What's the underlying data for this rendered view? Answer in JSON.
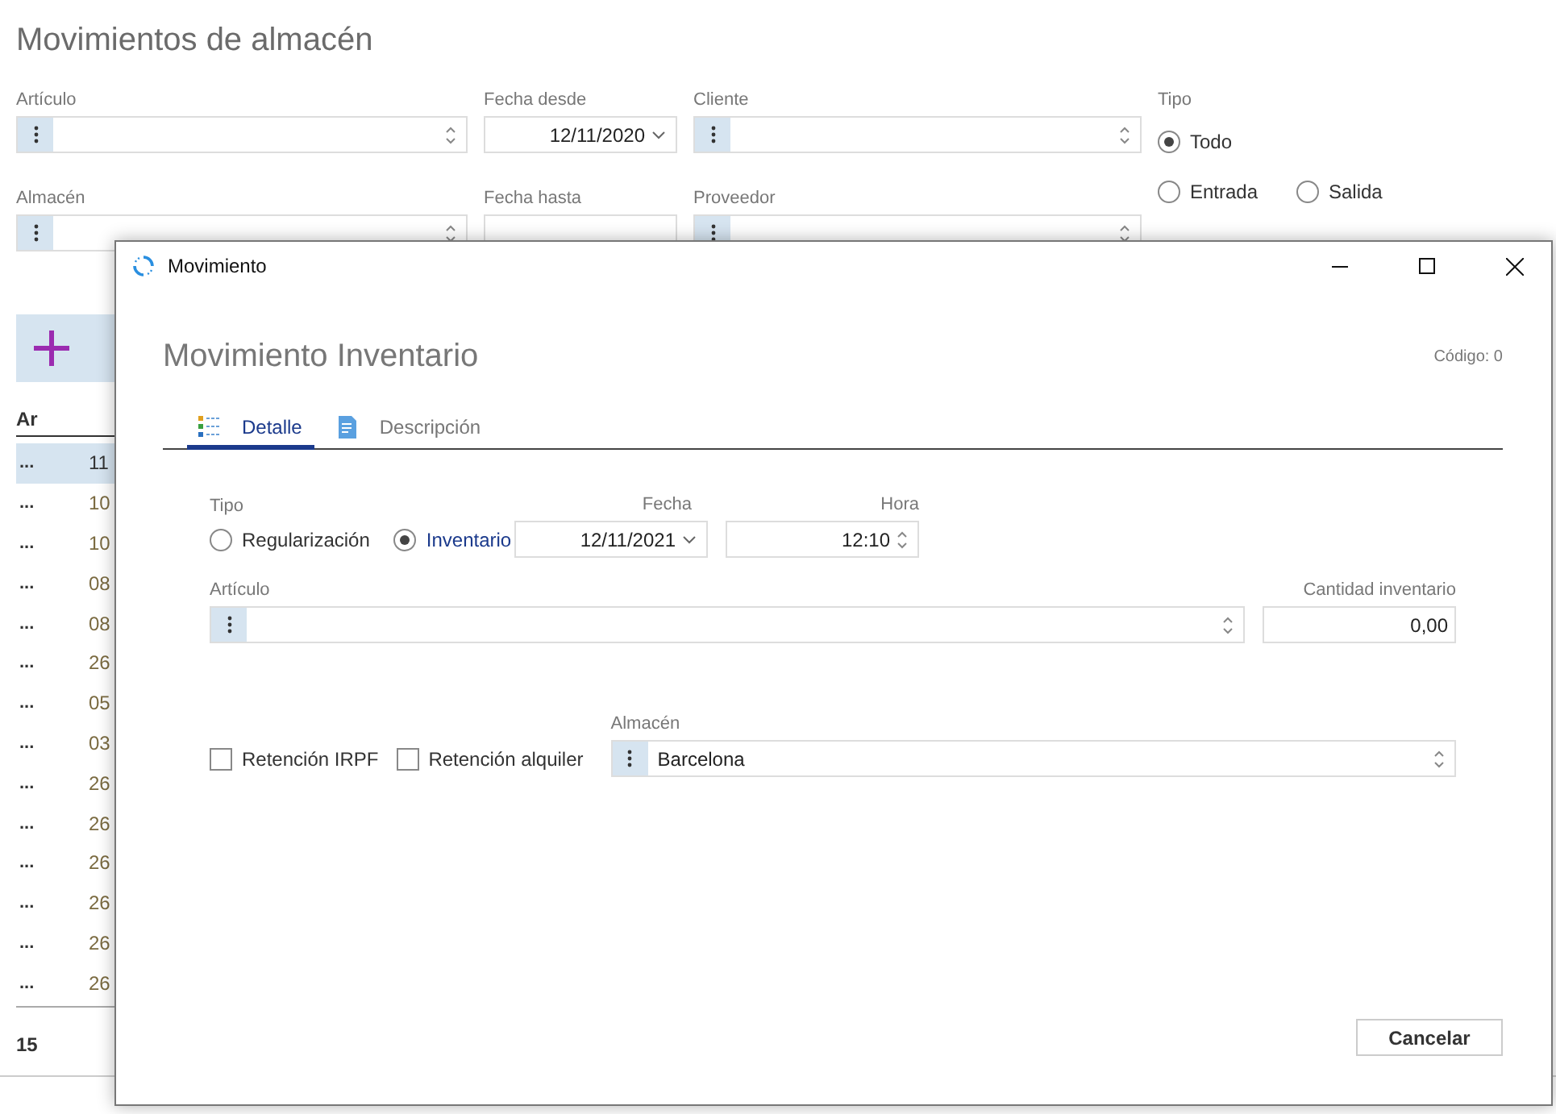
{
  "page": {
    "title": "Movimientos de almacén",
    "filter_columns": [
      [
        {
          "label": "Artículo",
          "kind": "lookup"
        },
        {
          "label": "Almacén",
          "kind": "lookup"
        }
      ],
      [
        {
          "label": "Fecha desde",
          "kind": "date",
          "value": "12/11/2020"
        },
        {
          "label": "Fecha hasta",
          "kind": "date"
        }
      ],
      [
        {
          "label": "Cliente",
          "kind": "lookup"
        },
        {
          "label": "Proveedor",
          "kind": "lookup"
        }
      ]
    ],
    "tipo": {
      "label": "Tipo",
      "options": [
        {
          "label": "Todo",
          "selected": true
        },
        {
          "label": "Entrada",
          "selected": false
        },
        {
          "label": "Salida",
          "selected": false
        }
      ]
    },
    "table": {
      "column_1": "Ar",
      "rows": [
        {
          "column_1": "...",
          "column_2": "11",
          "selected": true
        },
        {
          "column_1": "...",
          "column_2": "10",
          "selected": false
        },
        {
          "column_1": "...",
          "column_2": "10",
          "selected": false
        },
        {
          "column_1": "...",
          "column_2": "08",
          "selected": false
        },
        {
          "column_1": "...",
          "column_2": "08",
          "selected": false
        },
        {
          "column_1": "...",
          "column_2": "26",
          "selected": false
        },
        {
          "column_1": "...",
          "column_2": "05",
          "selected": false
        },
        {
          "column_1": "...",
          "column_2": "03",
          "selected": false
        },
        {
          "column_1": "...",
          "column_2": "26",
          "selected": false
        },
        {
          "column_1": "...",
          "column_2": "26",
          "selected": false
        },
        {
          "column_1": "...",
          "column_2": "26",
          "selected": false
        },
        {
          "column_1": "...",
          "column_2": "26",
          "selected": false
        },
        {
          "column_1": "...",
          "column_2": "26",
          "selected": false
        },
        {
          "column_1": "...",
          "column_2": "26",
          "selected": false
        }
      ],
      "count": "15"
    }
  },
  "dialog": {
    "title": "Movimiento",
    "heading": "Movimiento Inventario",
    "code": "Código: 0",
    "tabs": [
      {
        "label": "Detalle",
        "selected": true
      },
      {
        "label": "Descripción",
        "selected": false
      }
    ],
    "tipo": {
      "label": "Tipo",
      "options": [
        {
          "label": "Regularización",
          "selected": false
        },
        {
          "label": "Inventario",
          "selected": true
        }
      ]
    },
    "fecha": {
      "label": "Fecha",
      "value": "12/11/2021"
    },
    "hora": {
      "label": "Hora",
      "value": "12:10"
    },
    "articulo": {
      "label": "Artículo"
    },
    "cantidad": {
      "label": "Cantidad inventario",
      "value": "0,00"
    },
    "checkboxes": [
      {
        "label": "Retención IRPF",
        "checked": false
      },
      {
        "label": "Retención alquiler",
        "checked": false
      }
    ],
    "almacen": {
      "label": "Almacén",
      "value": "Barcelona"
    },
    "cancel": "Cancelar"
  }
}
